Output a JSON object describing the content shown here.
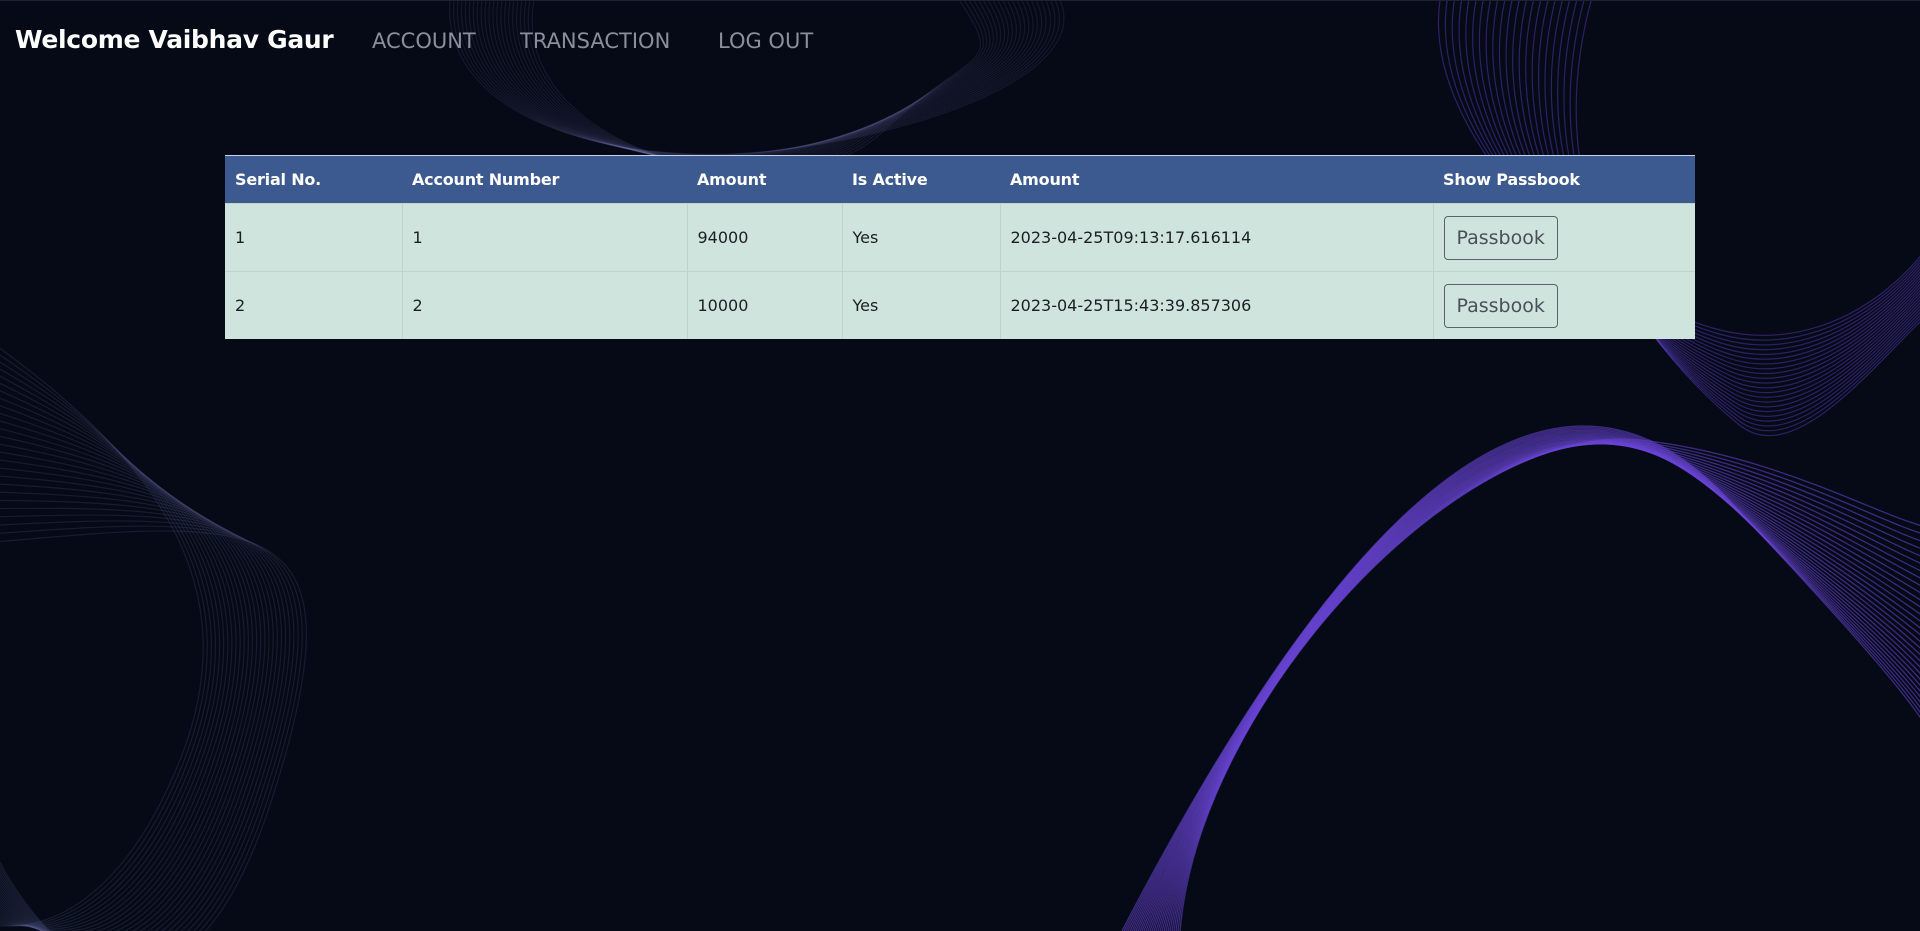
{
  "navbar": {
    "brand": "Welcome Vaibhav Gaur",
    "links": [
      {
        "label": "ACCOUNT"
      },
      {
        "label": "TRANSACTION"
      },
      {
        "label": "LOG OUT"
      }
    ]
  },
  "table": {
    "headers": [
      "Serial No.",
      "Account Number",
      "Amount",
      "Is Active",
      "Amount",
      "Show Passbook"
    ],
    "rows": [
      {
        "serial": "1",
        "account_number": "1",
        "amount": "94000",
        "is_active": "Yes",
        "date": "2023-04-25T09:13:17.616114",
        "action": "Passbook"
      },
      {
        "serial": "2",
        "account_number": "2",
        "amount": "10000",
        "is_active": "Yes",
        "date": "2023-04-25T15:43:39.857306",
        "action": "Passbook"
      }
    ]
  },
  "colors": {
    "background": "#060a17",
    "table_header": "#3c5a8f",
    "table_row": "#cfe4dc",
    "background_lines": "#5b3fc4"
  }
}
